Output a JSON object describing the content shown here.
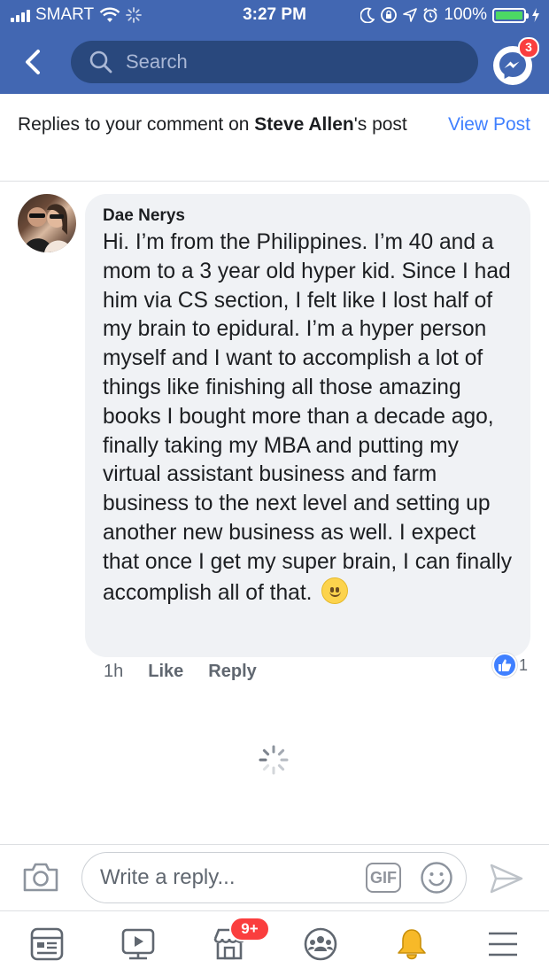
{
  "status_bar": {
    "carrier": "SMART",
    "time": "3:27 PM",
    "battery": "100%"
  },
  "header": {
    "search_placeholder": "Search",
    "messenger_badge": "3"
  },
  "notification": {
    "prefix": "Replies to your comment on ",
    "name": "Steve Allen",
    "suffix": "'s post",
    "view_post": "View Post"
  },
  "comment": {
    "author": "Dae Nerys",
    "text": "Hi. I’m from the Philippines. I’m 40 and a mom to a 3 year old hyper kid. Since I had him via CS section, I felt like I lost half of my brain to epidural. I’m a hyper person myself and I want to accomplish a lot of things like finishing all those amazing books I bought more than a decade ago, finally taking my MBA and putting my virtual assistant business and farm business to the next level and setting up another new business as well. I expect that once I get my super brain, I can finally accomplish all of that.",
    "time": "1h",
    "like_label": "Like",
    "reply_label": "Reply",
    "reaction_count": "1"
  },
  "composer": {
    "placeholder": "Write a reply...",
    "gif_label": "GIF"
  },
  "tab_bar": {
    "marketplace_badge": "9+"
  },
  "colors": {
    "brand": "#4267b2",
    "link": "#4080ff",
    "badge": "#fa3e3e",
    "bubble": "#f0f2f5"
  },
  "icons": [
    "back-icon",
    "search-icon",
    "messenger-icon",
    "camera-icon",
    "gif-icon",
    "smiley-icon",
    "send-icon",
    "news-feed-icon",
    "watch-icon",
    "marketplace-icon",
    "groups-icon",
    "bell-icon",
    "menu-icon"
  ]
}
